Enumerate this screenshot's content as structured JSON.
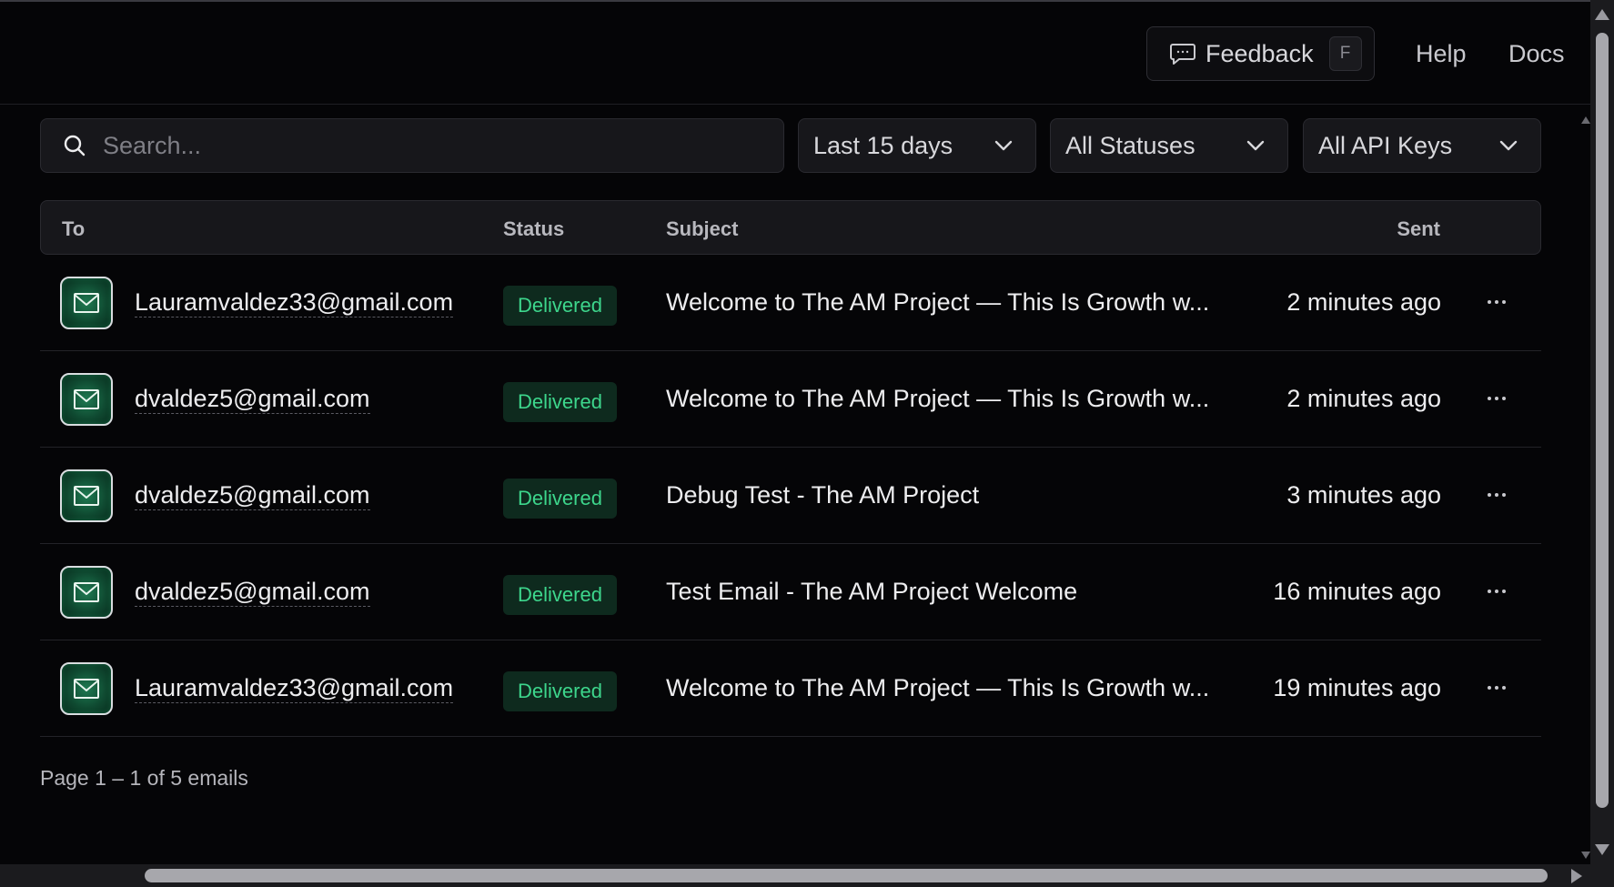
{
  "header": {
    "feedback_label": "Feedback",
    "feedback_shortcut": "F",
    "help_label": "Help",
    "docs_label": "Docs"
  },
  "filters": {
    "search_placeholder": "Search...",
    "date_range": "Last 15 days",
    "status": "All Statuses",
    "api_keys": "All API Keys"
  },
  "table": {
    "columns": {
      "to": "To",
      "status": "Status",
      "subject": "Subject",
      "sent": "Sent"
    },
    "rows": [
      {
        "to": "Lauramvaldez33@gmail.com",
        "status": "Delivered",
        "subject": "Welcome to The AM Project — This Is Growth w...",
        "sent": "2 minutes ago"
      },
      {
        "to": "dvaldez5@gmail.com",
        "status": "Delivered",
        "subject": "Welcome to The AM Project — This Is Growth w...",
        "sent": "2 minutes ago"
      },
      {
        "to": "dvaldez5@gmail.com",
        "status": "Delivered",
        "subject": "Debug Test - The AM Project",
        "sent": "3 minutes ago"
      },
      {
        "to": "dvaldez5@gmail.com",
        "status": "Delivered",
        "subject": "Test Email - The AM Project Welcome",
        "sent": "16 minutes ago"
      },
      {
        "to": "Lauramvaldez33@gmail.com",
        "status": "Delivered",
        "subject": "Welcome to The AM Project — This Is Growth w...",
        "sent": "19 minutes ago"
      }
    ]
  },
  "pagination": {
    "text": "Page 1 – 1 of 5 emails"
  },
  "icons": {
    "feedback": "message-dots-icon",
    "search": "search-icon",
    "dropdown": "chevron-down-icon",
    "row_avatar": "mail-icon",
    "row_actions": "more-horizontal-icon"
  },
  "colors": {
    "background": "#050507",
    "surface": "#17171b",
    "badge_bg": "#0e2a1e",
    "badge_text": "#3dd68c",
    "mail_icon_green": "#1f7a52"
  }
}
